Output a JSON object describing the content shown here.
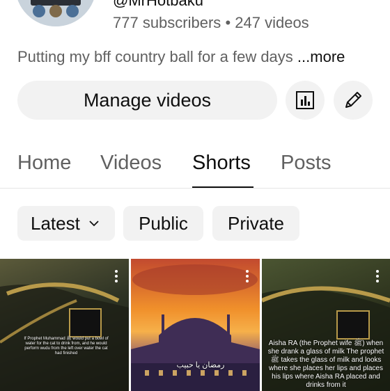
{
  "channel": {
    "handle": "@MrHotbaku",
    "subscribers": "777 subscribers",
    "separator": "•",
    "videos": "247 videos",
    "description": "Putting my bff country ball for a few days",
    "more": "...more"
  },
  "actions": {
    "manage_label": "Manage videos",
    "analytics_icon": "analytics-icon",
    "edit_icon": "pencil-icon"
  },
  "tabs": [
    {
      "label": "Home",
      "active": false
    },
    {
      "label": "Videos",
      "active": false
    },
    {
      "label": "Shorts",
      "active": true
    },
    {
      "label": "Posts",
      "active": false
    }
  ],
  "filters": {
    "sort_label": "Latest",
    "public_label": "Public",
    "private_label": "Private"
  },
  "shorts": [
    {
      "caption": "If Prophet Muhammad ﷺ would put a bowl of water for the cat to drink from, and he would perform wudu from the left over water the cat had finished"
    },
    {
      "caption": "رمضان يا حبيب"
    },
    {
      "caption": "Aisha RA (the Prophet wife ﷺ) when she drank a glass of milk The prophet ﷺ takes the glass of milk and looks where she places her lips and places his lips where Aisha RA placed and drinks from it"
    }
  ],
  "colors": {
    "text_primary": "#0f0f0f",
    "text_secondary": "#606060",
    "chip_bg": "#f2f2f2"
  }
}
